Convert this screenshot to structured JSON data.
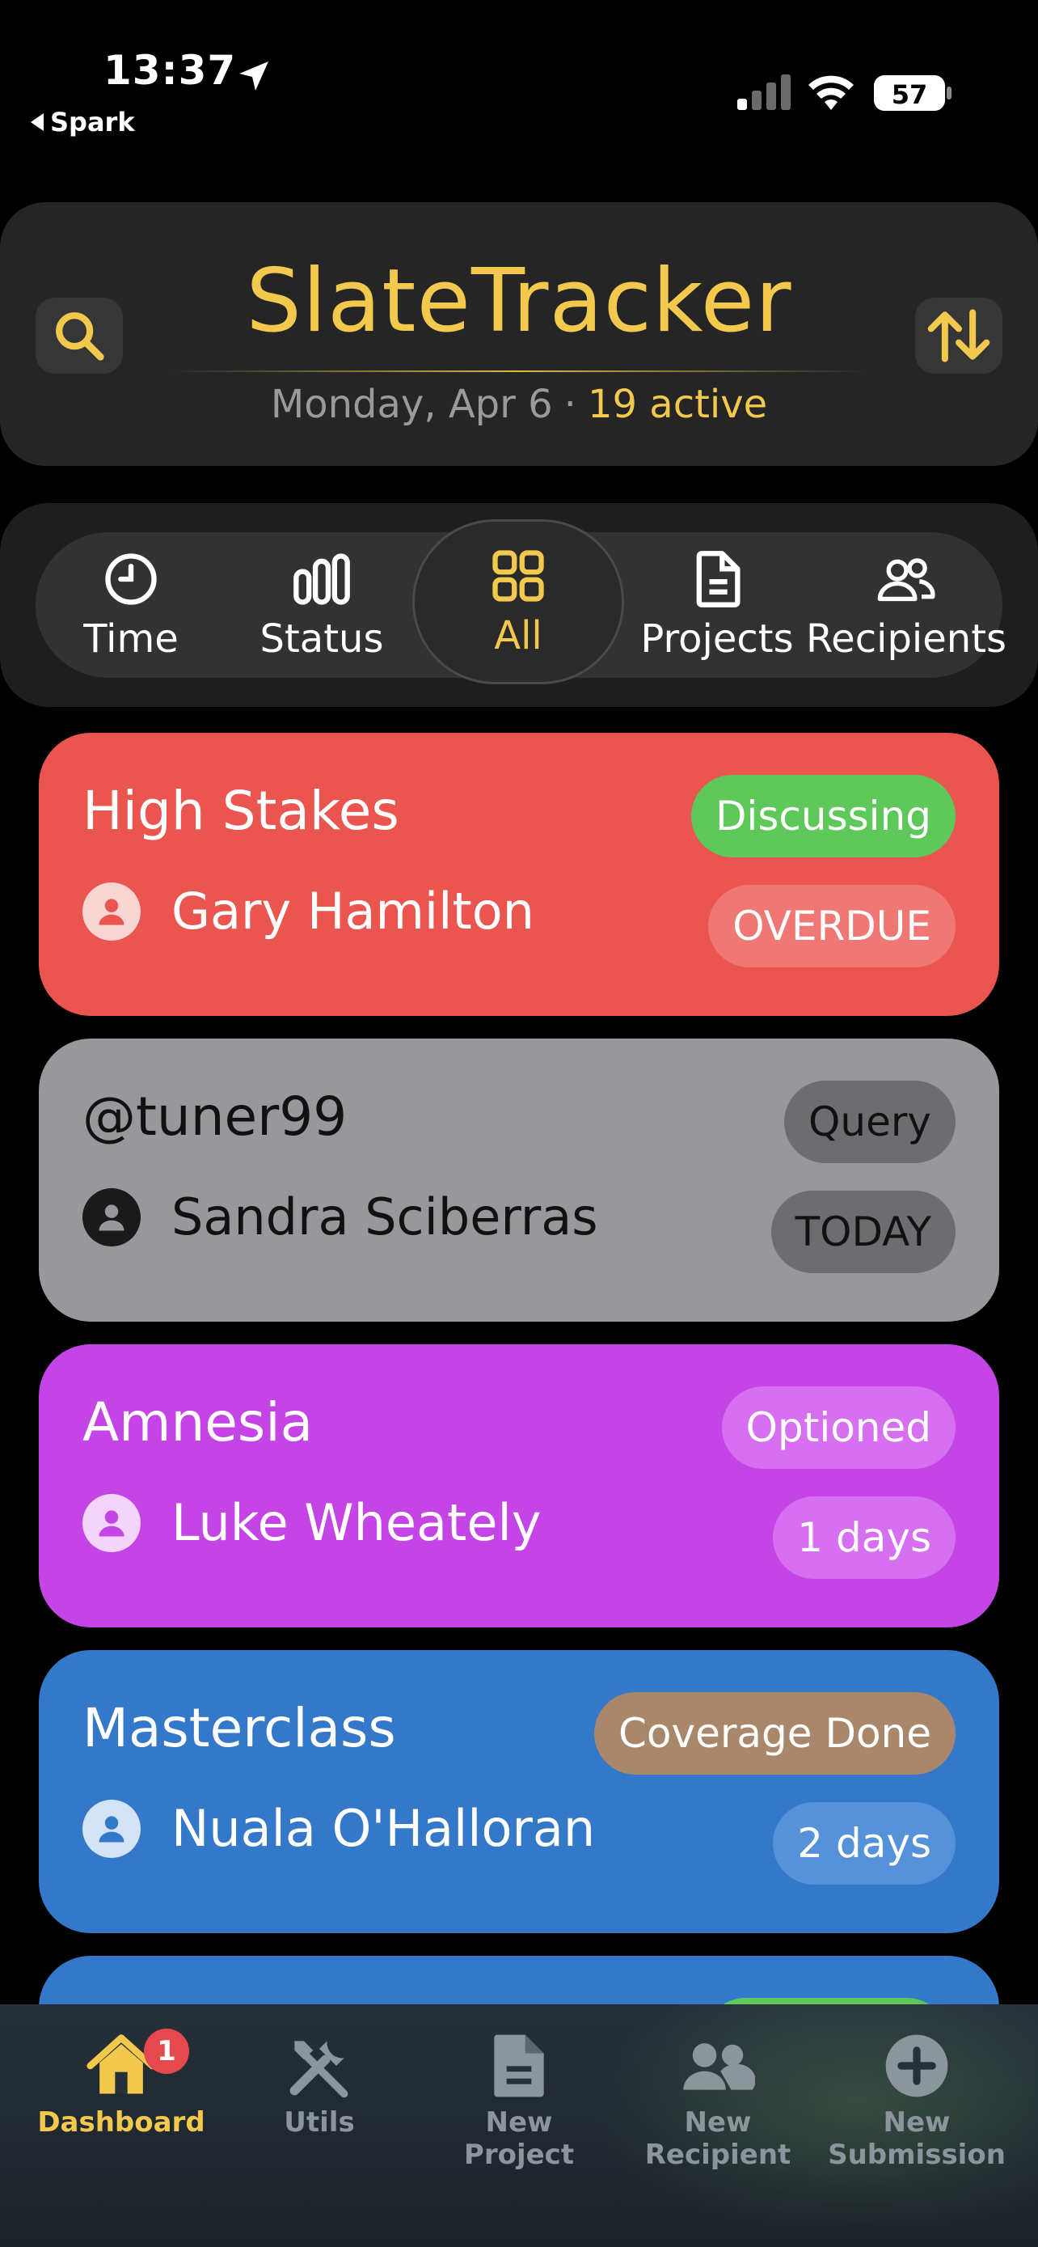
{
  "status_bar": {
    "time": "13:37",
    "back_app": "Spark",
    "battery": "57"
  },
  "header": {
    "title": "SlateTracker",
    "date": "Monday, Apr 6",
    "separator": "·",
    "active_count": "19 active",
    "search_icon": "search-icon",
    "sort_icon": "sort-icon"
  },
  "filters": {
    "selected": "All",
    "items": [
      {
        "label": "Time",
        "icon": "clock-icon"
      },
      {
        "label": "Status",
        "icon": "bars-icon"
      },
      {
        "label": "All",
        "icon": "grid-icon"
      },
      {
        "label": "Projects",
        "icon": "document-icon"
      },
      {
        "label": "Recipients",
        "icon": "people-icon"
      }
    ]
  },
  "cards": [
    {
      "title": "High Stakes",
      "status": "Discussing",
      "person": "Gary Hamilton",
      "due": "OVERDUE",
      "color": "#ea5550",
      "status_color": "#5ec85b"
    },
    {
      "title": "@tuner99",
      "status": "Query",
      "person": "Sandra Sciberras",
      "due": "TODAY",
      "color": "#98979c",
      "status_color": "#6d6c70"
    },
    {
      "title": "Amnesia",
      "status": "Optioned",
      "person": "Luke Wheately",
      "due": "1 days",
      "color": "#c544e6",
      "status_color": "#d66ff0"
    },
    {
      "title": "Masterclass",
      "status": "Coverage Done",
      "person": "Nuala O'Halloran",
      "due": "2 days",
      "color": "#3478c9",
      "status_color": "#a9876a"
    }
  ],
  "tab_bar": {
    "items": [
      {
        "label": "Dashboard",
        "icon": "home-icon",
        "badge": "1"
      },
      {
        "label": "Utils",
        "icon": "tools-icon"
      },
      {
        "label": "New\nProject",
        "icon": "new-document-icon"
      },
      {
        "label": "New\nRecipient",
        "icon": "new-people-icon"
      },
      {
        "label": "New\nSubmission",
        "icon": "plus-circle-icon"
      }
    ]
  },
  "colors": {
    "accent": "#f2c94c",
    "background": "#000000",
    "header_bg": "#252525"
  }
}
